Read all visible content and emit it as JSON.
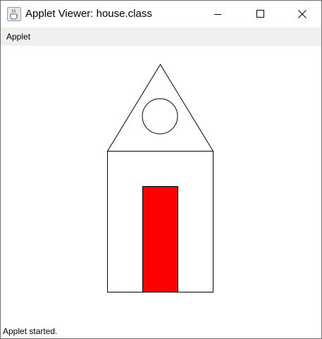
{
  "window": {
    "title": "Applet Viewer: house.class",
    "icon": "java-coffee-cup-icon",
    "controls": {
      "minimize_icon": "minimize-icon",
      "maximize_icon": "maximize-icon",
      "close_icon": "close-icon"
    }
  },
  "menubar": {
    "items": [
      {
        "label": "Applet"
      }
    ]
  },
  "drawing": {
    "shapes": [
      "roof-triangle",
      "window-circle",
      "house-body-rectangle",
      "door-rectangle"
    ],
    "colors": {
      "outline": "#000000",
      "door_fill": "#ff0000",
      "background": "#ffffff"
    }
  },
  "statusbar": {
    "text": "Applet started."
  }
}
